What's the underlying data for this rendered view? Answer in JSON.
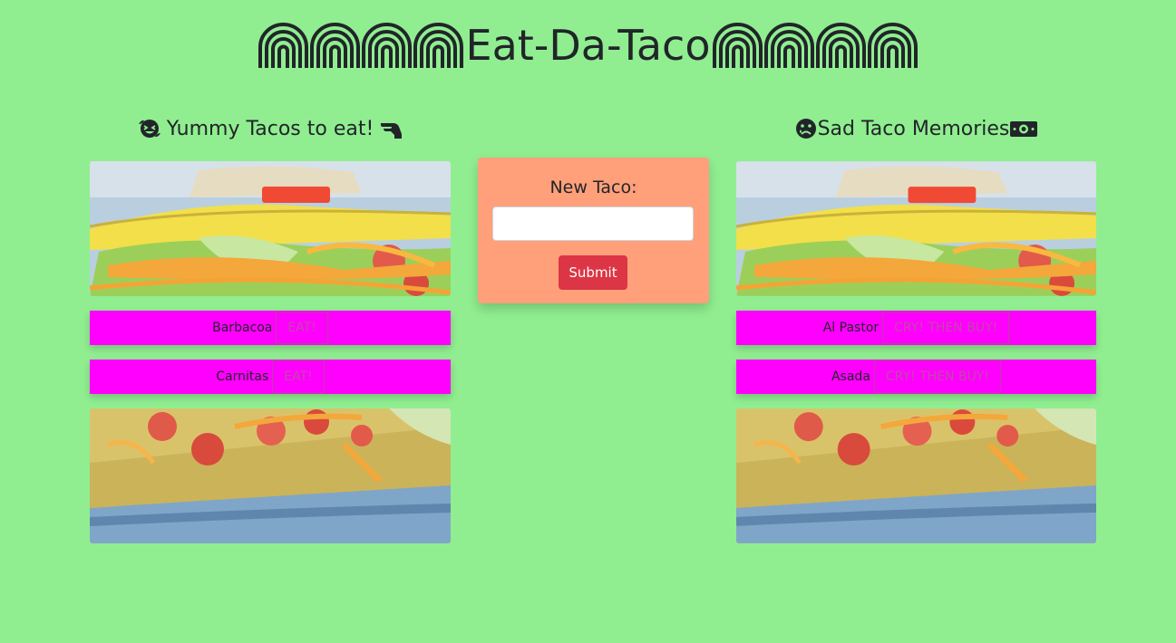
{
  "header": {
    "title": "Eat-Da-Taco",
    "decoration_icon": "rainbow-arch-icon"
  },
  "yummy": {
    "title": "Yummy Tacos to eat!",
    "leading_icon": "grin-squint-tears-icon",
    "trailing_icon": "hand-lizard-icon",
    "button_label": "EAT!",
    "items": [
      {
        "name": "Barbacoa"
      },
      {
        "name": "Carnitas"
      }
    ]
  },
  "form": {
    "label": "New Taco:",
    "input_value": "",
    "submit_label": "Submit"
  },
  "sad": {
    "title": "Sad Taco Memories",
    "leading_icon": "sad-tear-icon",
    "trailing_icon": "money-bill-icon",
    "button_label": "CRY! THEN BUY!",
    "items": [
      {
        "name": "Al Pastor"
      },
      {
        "name": "Asada"
      }
    ]
  },
  "colors": {
    "page_background": "#90ee90",
    "row_background": "#ff00ff",
    "form_background": "#ffa07a",
    "submit_button": "#dc3545",
    "text": "#212529"
  }
}
